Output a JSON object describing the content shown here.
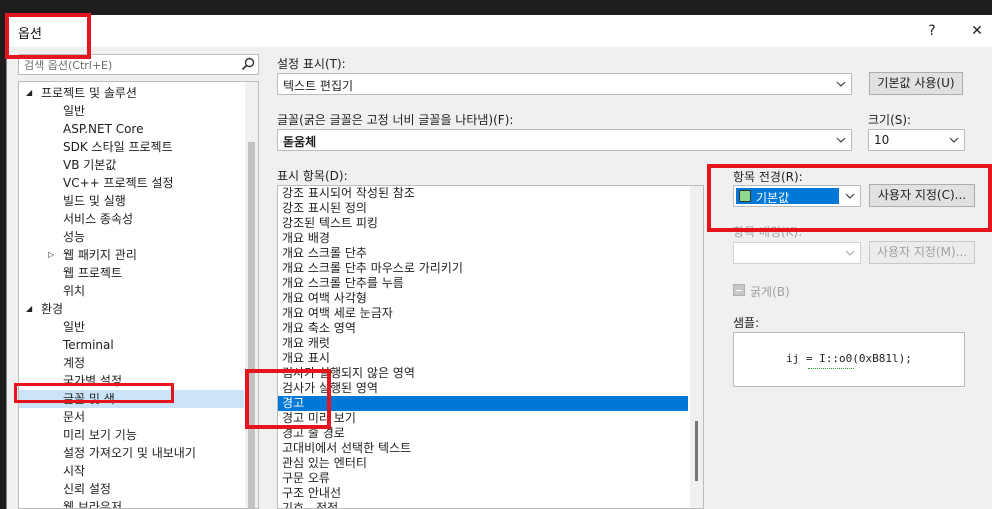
{
  "dialog": {
    "title": "옵션",
    "help": "?",
    "close": "✕"
  },
  "search": {
    "placeholder": "검색 옵션(Ctrl+E)"
  },
  "tree": {
    "items": [
      {
        "label": "프로젝트 및 솔루션",
        "level": 0,
        "expanded": true
      },
      {
        "label": "일반",
        "level": 1
      },
      {
        "label": "ASP.NET Core",
        "level": 1
      },
      {
        "label": "SDK 스타일 프로젝트",
        "level": 1
      },
      {
        "label": "VB 기본값",
        "level": 1
      },
      {
        "label": "VC++ 프로젝트 설정",
        "level": 1
      },
      {
        "label": "빌드 및 실행",
        "level": 1
      },
      {
        "label": "서비스 종속성",
        "level": 1
      },
      {
        "label": "성능",
        "level": 1
      },
      {
        "label": "웹 패키지 관리",
        "level": 1,
        "collapsed": true
      },
      {
        "label": "웹 프로젝트",
        "level": 1
      },
      {
        "label": "위치",
        "level": 1
      },
      {
        "label": "환경",
        "level": 0,
        "expanded": true
      },
      {
        "label": "일반",
        "level": 1
      },
      {
        "label": "Terminal",
        "level": 1
      },
      {
        "label": "계정",
        "level": 1
      },
      {
        "label": "국가별 설정",
        "level": 1
      },
      {
        "label": "글꼴 및 색",
        "level": 1,
        "selected": true
      },
      {
        "label": "문서",
        "level": 1
      },
      {
        "label": "미리 보기 기능",
        "level": 1
      },
      {
        "label": "설정 가져오기 및 내보내기",
        "level": 1
      },
      {
        "label": "시작",
        "level": 1
      },
      {
        "label": "신뢰 설정",
        "level": 1
      },
      {
        "label": "웹 브라우저",
        "level": 1
      }
    ]
  },
  "settings": {
    "show_settings_label": "설정 표시(T):",
    "show_settings_value": "텍스트 편집기",
    "use_defaults_button": "기본값 사용(U)",
    "font_label": "글꼴(굵은 글꼴은 고정 너비 글꼴을 나타냄)(F):",
    "font_value": "돋움체",
    "size_label": "크기(S):",
    "size_value": "10",
    "display_items_label": "표시 항목(D):",
    "fg_label": "항목 전경(R):",
    "fg_value": "기본값",
    "custom_button": "사용자 지정(C)...",
    "bg_label": "항목 배경(K):",
    "custom_bg_button": "사용자 지정(M)...",
    "bold_label": "굵게(B)",
    "sample_label": "샘플:",
    "sample_text": "ij = I::o0(0xB81l);"
  },
  "display_items": [
    "강조 표시되어 작성된 참조",
    "강조 표시된 정의",
    "강조된 텍스트 피킹",
    "개요 배경",
    "개요 스크롤 단추",
    "개요 스크롤 단추 마우스로 가리키기",
    "개요 스크롤 단추를 누름",
    "개요 여백 사각형",
    "개요 여백 세로 눈금자",
    "개요 축소 영역",
    "개요 캐럿",
    "개요 표시",
    "검사가 실행되지 않은 영역",
    "검사가 실행된 영역",
    "경고",
    "경고 미리 보기",
    "경고 줄 경로",
    "고대비에서 선택한 텍스트",
    "관심 있는 엔터티",
    "구문 오류",
    "구조 안내선",
    "기호 - 정적"
  ],
  "selected_display_item": "경고",
  "colors": {
    "selection_blue": "#0078d7",
    "tree_selection": "#cce4f7",
    "highlight_red": "#e5141d",
    "swatch_green": "#8ed98e"
  }
}
